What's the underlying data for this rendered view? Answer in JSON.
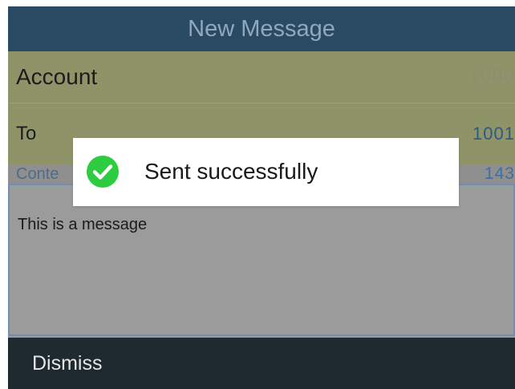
{
  "header": {
    "title": "New Message"
  },
  "fields": {
    "account": {
      "label": "Account",
      "value": "1000"
    },
    "to": {
      "label": "To",
      "value": "1001"
    },
    "content": {
      "label": "Conte",
      "count": "143"
    }
  },
  "message": {
    "text": "This is a message"
  },
  "footer": {
    "dismiss_label": "Dismiss"
  },
  "toast": {
    "text": "Sent successfully",
    "icon": "check-circle-icon",
    "icon_color": "#2ecc40"
  },
  "colors": {
    "header_bg": "#2a4a64",
    "row_bg": "#8f9468",
    "footer_bg": "#1f2a30"
  }
}
